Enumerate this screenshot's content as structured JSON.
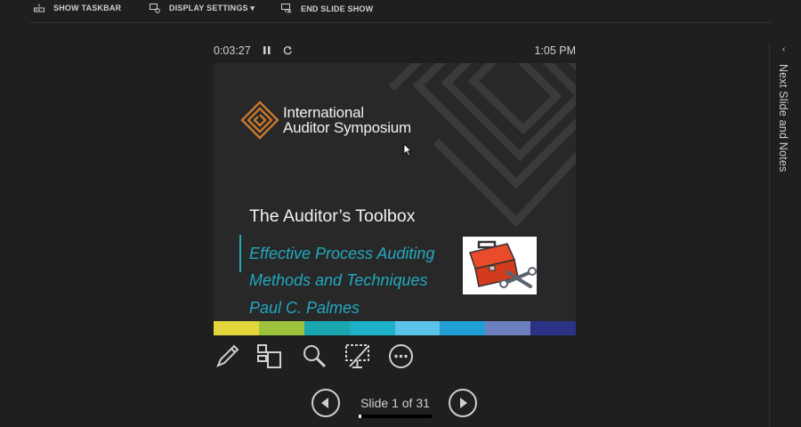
{
  "toolbar": {
    "show_taskbar": "SHOW TASKBAR",
    "display_settings": "DISPLAY SETTINGS ▾",
    "end_slide_show": "END SLIDE SHOW"
  },
  "presenter": {
    "elapsed_time": "0:03:27",
    "clock": "1:05 PM",
    "next_slide_notes": "Next Slide and Notes"
  },
  "slide": {
    "brand_line1": "International",
    "brand_line2": "Auditor Symposium",
    "title": "The Auditor’s Toolbox",
    "subtitle_line1": "Effective Process Auditing",
    "subtitle_line2": "Methods and Techniques",
    "author": "Paul C. Palmes",
    "stripe_colors": [
      "#e3d63b",
      "#9dc33c",
      "#1aa6b1",
      "#1cb1c7",
      "#5bc2e8",
      "#1f9fd3",
      "#6c7fbf",
      "#2c3286"
    ]
  },
  "navigation": {
    "slide_indicator": "Slide 1 of 31",
    "progress_fraction": 0.0323
  },
  "icons": [
    "pen-icon",
    "all-slides-icon",
    "zoom-icon",
    "black-screen-icon",
    "more-options-icon",
    "previous-slide-icon",
    "next-slide-icon",
    "pause-icon",
    "reset-timer-icon"
  ]
}
